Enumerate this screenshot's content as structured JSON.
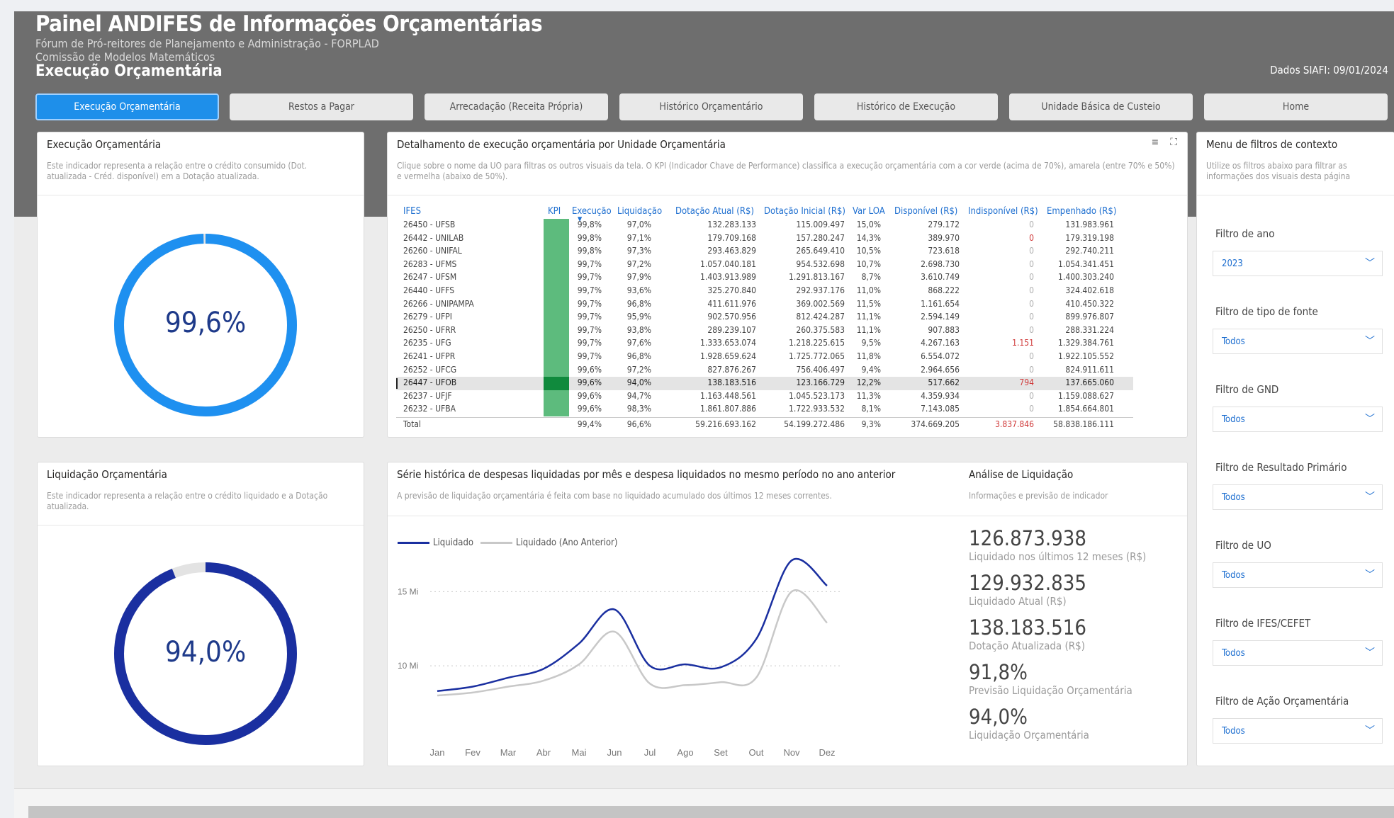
{
  "header": {
    "title": "Painel ANDIFES de Informações Orçamentárias",
    "sub1": "Fórum de Pró-reitores de Planejamento e Administração - FORPLAD",
    "sub2": "Comissão de Modelos Matemáticos",
    "section": "Execução Orçamentária",
    "date": "Dados SIAFI: 09/01/2024"
  },
  "tabs": [
    {
      "label": "Execução Orçamentária"
    },
    {
      "label": "Restos a Pagar"
    },
    {
      "label": "Arrecadação (Receita Própria)"
    },
    {
      "label": "Histórico Orçamentário"
    },
    {
      "label": "Histórico de Execução"
    },
    {
      "label": "Unidade Básica de Custeio"
    },
    {
      "label": "Home"
    }
  ],
  "exec_panel": {
    "title": "Execução Orçamentária",
    "desc": "Este indicador representa a relação entre o crédito consumido (Dot. atualizada - Créd. disponível) em a Dotação atualizada.",
    "value_label": "99,6%",
    "value": 99.6,
    "color": "#1e90f0"
  },
  "liq_panel": {
    "title": "Liquidação Orçamentária",
    "desc": "Este indicador representa a relação entre o crédito liquidado e a Dotação atualizada.",
    "value_label": "94,0%",
    "value": 94.0,
    "color": "#1a2fa0"
  },
  "detail_panel": {
    "title": "Detalhamento de execução orçamentária por Unidade Orçamentária",
    "desc": "Clique sobre o nome da UO para filtras os outros visuais da tela. O KPI (Indicador Chave de Performance) classifica a execução orçamentária com a cor verde (acima de 70%), amarela (entre 70% e 50%) e vermelha (abaixo de 50%).",
    "columns": [
      "IFES",
      "KPI",
      "Execução",
      "Liquidação",
      "Dotação Atual (R$)",
      "Dotação Inicial (R$)",
      "Var LOA",
      "Disponível (R$)",
      "Indisponível (R$)",
      "Empenhado (R$)"
    ],
    "rows": [
      [
        "26450 - UFSB",
        "",
        "99,8%",
        "97,0%",
        "132.283.133",
        "115.009.497",
        "15,0%",
        "279.172",
        "0",
        "131.983.961"
      ],
      [
        "26442 - UNILAB",
        "",
        "99,8%",
        "97,1%",
        "179.709.168",
        "157.280.247",
        "14,3%",
        "389.970",
        "0",
        "179.319.198"
      ],
      [
        "26260 - UNIFAL",
        "",
        "99,8%",
        "97,3%",
        "293.463.829",
        "265.649.410",
        "10,5%",
        "723.618",
        "0",
        "292.740.211"
      ],
      [
        "26283 - UFMS",
        "",
        "99,7%",
        "97,2%",
        "1.057.040.181",
        "954.532.698",
        "10,7%",
        "2.698.730",
        "0",
        "1.054.341.451"
      ],
      [
        "26247 - UFSM",
        "",
        "99,7%",
        "97,9%",
        "1.403.913.989",
        "1.291.813.167",
        "8,7%",
        "3.610.749",
        "0",
        "1.400.303.240"
      ],
      [
        "26440 - UFFS",
        "",
        "99,7%",
        "93,6%",
        "325.270.840",
        "292.937.176",
        "11,0%",
        "868.222",
        "0",
        "324.402.618"
      ],
      [
        "26266 - UNIPAMPA",
        "",
        "99,7%",
        "96,8%",
        "411.611.976",
        "369.002.569",
        "11,5%",
        "1.161.654",
        "0",
        "410.450.322"
      ],
      [
        "26279 - UFPI",
        "",
        "99,7%",
        "95,9%",
        "902.570.956",
        "812.424.287",
        "11,1%",
        "2.594.149",
        "0",
        "899.976.807"
      ],
      [
        "26250 - UFRR",
        "",
        "99,7%",
        "93,8%",
        "289.239.107",
        "260.375.583",
        "11,1%",
        "907.883",
        "0",
        "288.331.224"
      ],
      [
        "26235 - UFG",
        "",
        "99,7%",
        "97,6%",
        "1.333.653.074",
        "1.218.225.615",
        "9,5%",
        "4.267.163",
        "1.151",
        "1.329.384.761"
      ],
      [
        "26241 - UFPR",
        "",
        "99,7%",
        "96,8%",
        "1.928.659.624",
        "1.725.772.065",
        "11,8%",
        "6.554.072",
        "0",
        "1.922.105.552"
      ],
      [
        "26252 - UFCG",
        "",
        "99,6%",
        "97,2%",
        "827.876.267",
        "756.406.497",
        "9,4%",
        "2.964.656",
        "0",
        "824.911.611"
      ],
      [
        "26447 - UFOB",
        "",
        "99,6%",
        "94,0%",
        "138.183.516",
        "123.166.729",
        "12,2%",
        "517.662",
        "794",
        "137.665.060"
      ],
      [
        "26237 - UFJF",
        "",
        "99,6%",
        "94,7%",
        "1.163.448.561",
        "1.045.523.173",
        "11,3%",
        "4.359.934",
        "0",
        "1.159.088.627"
      ],
      [
        "26232 - UFBA",
        "",
        "99,6%",
        "98,3%",
        "1.861.807.886",
        "1.722.933.532",
        "8,1%",
        "7.143.085",
        "0",
        "1.854.664.801"
      ]
    ],
    "total": [
      "Total",
      "",
      "99,4%",
      "96,6%",
      "59.216.693.162",
      "54.199.272.486",
      "9,3%",
      "374.669.205",
      "3.837.846",
      "58.838.186.111"
    ],
    "selected_row": 12
  },
  "series_panel": {
    "title": "Série histórica de despesas liquidadas por mês e despesa liquidados no mesmo período no ano anterior",
    "desc": "A previsão de liquidação orçamentária é feita com base no liquidado acumulado dos últimos 12 meses correntes."
  },
  "chart_data": {
    "type": "line",
    "categories": [
      "Jan",
      "Fev",
      "Mar",
      "Abr",
      "Mai",
      "Jun",
      "Jul",
      "Ago",
      "Set",
      "Out",
      "Nov",
      "Dez"
    ],
    "series": [
      {
        "name": "Liquidado",
        "color": "#1a2fa0",
        "values": [
          8.3,
          8.6,
          9.2,
          9.8,
          11.5,
          13.8,
          10.0,
          10.1,
          9.9,
          11.8,
          17.1,
          15.4
        ]
      },
      {
        "name": "Liquidado (Ano Anterior)",
        "color": "#c8c8c8",
        "values": [
          8.0,
          8.2,
          8.6,
          9.0,
          10.1,
          12.3,
          8.8,
          8.7,
          8.9,
          9.2,
          15.0,
          12.9
        ]
      }
    ],
    "y_ticks": [
      "15 Mi",
      "10 Mi"
    ],
    "ylim": [
      7,
      17.5
    ]
  },
  "analysis_panel": {
    "title": "Análise de Liquidação",
    "desc": "Informações e previsão de indicador",
    "stats": [
      {
        "value": "126.873.938",
        "label": "Liquidado nos últimos 12 meses (R$)"
      },
      {
        "value": "129.932.835",
        "label": "Liquidado Atual (R$)"
      },
      {
        "value": "138.183.516",
        "label": "Dotação Atualizada (R$)"
      },
      {
        "value": "91,8%",
        "label": "Previsão Liquidação Orçamentária"
      },
      {
        "value": "94,0%",
        "label": "Liquidação Orçamentária"
      }
    ]
  },
  "filters_panel": {
    "title": "Menu de filtros de contexto",
    "desc": "Utilize os filtros abaixo para filtrar as informações dos visuais desta página",
    "filters": [
      {
        "label": "Filtro de ano",
        "value": "2023"
      },
      {
        "label": "Filtro de tipo de fonte",
        "value": "Todos"
      },
      {
        "label": "Filtro de GND",
        "value": "Todos"
      },
      {
        "label": "Filtro de Resultado Primário",
        "value": "Todos"
      },
      {
        "label": "Filtro de UO",
        "value": "Todos"
      },
      {
        "label": "Filtro de IFES/CEFET",
        "value": "Todos"
      },
      {
        "label": "Filtro de Ação Orçamentária",
        "value": "Todos"
      }
    ]
  }
}
